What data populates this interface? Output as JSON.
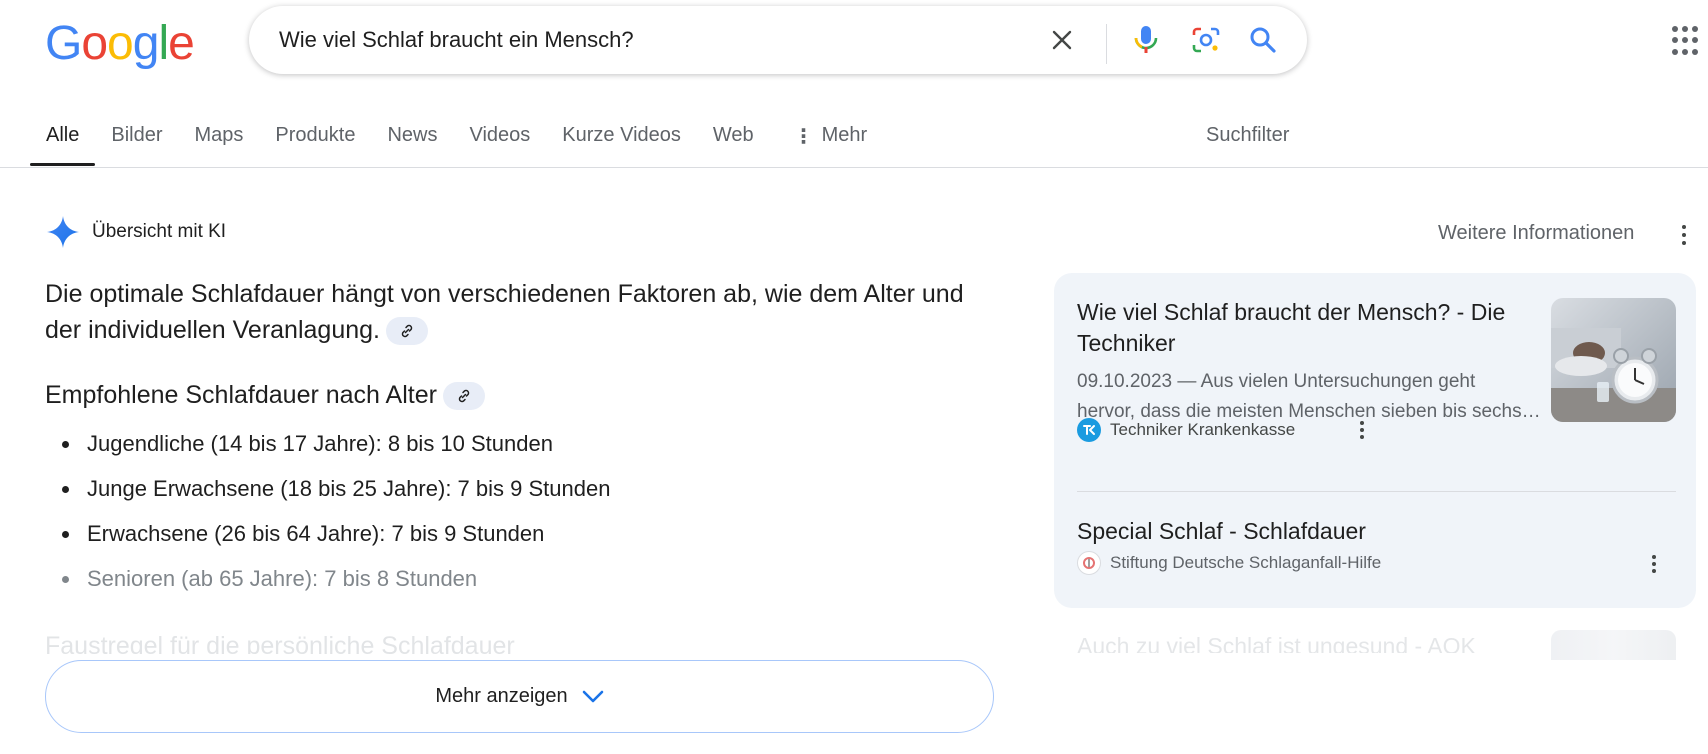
{
  "logo": {
    "letters": [
      "G",
      "o",
      "o",
      "g",
      "l",
      "e"
    ]
  },
  "search": {
    "query": "Wie viel Schlaf braucht ein Mensch?"
  },
  "tabs": [
    {
      "label": "Alle"
    },
    {
      "label": "Bilder"
    },
    {
      "label": "Maps"
    },
    {
      "label": "Produkte"
    },
    {
      "label": "News"
    },
    {
      "label": "Videos"
    },
    {
      "label": "Kurze Videos"
    },
    {
      "label": "Web"
    },
    {
      "label": "Mehr"
    }
  ],
  "filter_label": "Suchfilter",
  "ai_overview": {
    "title": "Übersicht mit KI",
    "more_info": "Weitere Informationen",
    "intro": "Die optimale Schlafdauer hängt von verschiedenen Faktoren ab, wie dem Alter und der individuellen Veranlagung.",
    "section_title": "Empfohlene Schlafdauer nach Alter",
    "bullets": [
      "Jugendliche (14 bis 17 Jahre): 8 bis 10 Stunden",
      "Junge Erwachsene (18 bis 25 Jahre): 7 bis 9 Stunden",
      "Erwachsene (26 bis 64 Jahre): 7 bis 9 Stunden",
      "Senioren (ab 65 Jahre): 7 bis 8 Stunden"
    ],
    "next_heading": "Faustregel für die persönliche Schlafdauer",
    "show_more": "Mehr anzeigen"
  },
  "sources": [
    {
      "title": "Wie viel Schlaf braucht der Mensch? - Die Techniker",
      "snippet_line1": "09.10.2023 — Aus vielen Untersuchungen geht",
      "snippet_line2": "hervor, dass die meisten Menschen sieben bis sechs Stunden Schlaf brauchen",
      "site": "Techniker Krankenkasse"
    },
    {
      "title": "Special Schlaf - Schlafdauer",
      "site": "Stiftung Deutsche Schlaganfall-Hilfe"
    },
    {
      "title": "Auch zu viel Schlaf ist ungesund - AOK"
    }
  ],
  "colors": {
    "blue": "#4285F4",
    "red": "#EA4335",
    "yellow": "#FBBC05",
    "green": "#34A853",
    "panel_bg": "#f0f4f9"
  }
}
